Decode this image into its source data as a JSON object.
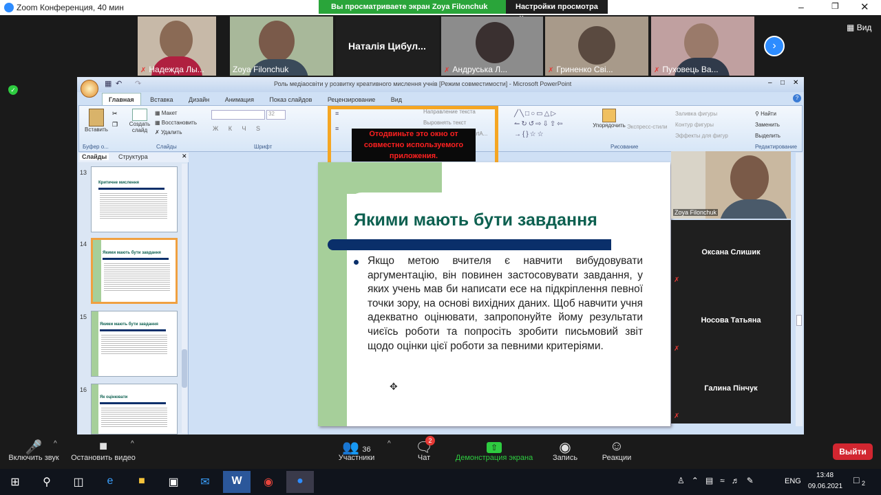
{
  "window": {
    "title": "Zoom Конференция, 40 мин"
  },
  "banner": {
    "viewing": "Вы просматриваете экран Zoya Filonchuk",
    "settings": "Настройки просмотра"
  },
  "view_button": "Вид",
  "participants_strip": [
    {
      "name": "Надежда Лы..."
    },
    {
      "name": "Zoya Filonchuk"
    },
    {
      "name": "Наталія Цибул..."
    },
    {
      "name": "Андруська Л..."
    },
    {
      "name": "Гриненко Сві..."
    },
    {
      "name": "Пуховець Ва..."
    }
  ],
  "ppt": {
    "title": "Роль медіаосвіти у розвитку креативного мислення учнів [Режим совместимости] - Microsoft PowerPoint",
    "tabs": [
      "Главная",
      "Вставка",
      "Дизайн",
      "Анимация",
      "Показ слайдов",
      "Рецензирование",
      "Вид"
    ],
    "groups": {
      "clipboard": "Буфер о...",
      "slides": "Слайды",
      "font": "Шрифт",
      "drawing": "Рисование",
      "editing": "Редактирование"
    },
    "buttons": {
      "paste": "Вставить",
      "new_slide": "Создать слайд",
      "layout": "Макет",
      "reset": "Восстановить",
      "delete": "Удалить",
      "font_size": "32",
      "text_direction": "Направление текста",
      "align_text": "Выровнять текст",
      "smartart": "SmartA...",
      "arrange": "Упорядочить",
      "quick_styles": "Экспресс-стили",
      "shape_fill": "Заливка фигуры",
      "shape_outline": "Контур фигуры",
      "shape_effects": "Эффекты для фигур",
      "find": "Найти",
      "replace": "Заменить",
      "select": "Выделить"
    },
    "panel_tabs": [
      "Слайды",
      "Структура"
    ],
    "thumb_numbers": [
      "13",
      "14",
      "15",
      "16"
    ],
    "thumb_titles": [
      "Критичне мислення",
      "Якими мають бути завдання",
      "Якими мають бути завдання",
      "Як оцінювати"
    ],
    "slide": {
      "title": "Якими мають бути завдання",
      "body": "Якщо метою вчителя є навчити вибудовувати аргументацію, він повинен застосовувати завдання, у яких учень мав би написати есе на підкріплення певної точки зору, на основі вихідних даних. Щоб навчити учня адекватно оцінювати, запропонуйте йому результати чиєїсь роботи та попросіть зробити письмовий звіт щодо оцінки цієї роботи за певними критеріями."
    },
    "warning": "Отодвиньте это окно от совместно используемого приложения."
  },
  "side_video": {
    "name": "Zoya Filonchuk"
  },
  "side_participants": [
    "Оксана Слишик",
    "Носова Татьяна",
    "Галина Пінчук"
  ],
  "controls": {
    "unmute": "Включить звук",
    "stop_video": "Остановить видео",
    "participants": "Участники",
    "participants_count": "36",
    "chat": "Чат",
    "chat_badge": "2",
    "share": "Демонстрация экрана",
    "record": "Запись",
    "reactions": "Реакции",
    "leave": "Выйти"
  },
  "taskbar": {
    "lang": "ENG",
    "time": "13:48",
    "date": "09.06.2021",
    "notif": "2"
  },
  "colors": {
    "share_green": "#2aa53a",
    "leave_red": "#d22630",
    "warning_orange": "#f5a623",
    "slide_title": "#0d6050",
    "slide_bar": "#0a2f6a"
  }
}
